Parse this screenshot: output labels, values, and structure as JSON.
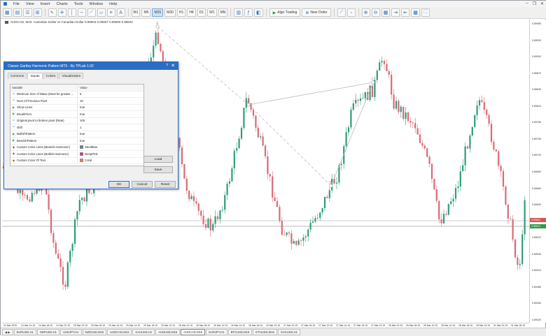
{
  "menu": {
    "items": [
      "File",
      "View",
      "Insert",
      "Charts",
      "Tools",
      "Window",
      "Help"
    ]
  },
  "toolbar": {
    "timeframes": [
      "M1",
      "M5",
      "M15",
      "M30",
      "H1",
      "H4",
      "D1",
      "W1",
      "MN"
    ],
    "active_timeframe": "M15",
    "algo_label": "Algo Trading",
    "new_order_label": "New Order"
  },
  "chart": {
    "info": "AUDCAD, M15: Australian Dollar vs Canadian Dollar 0.89603 0.89607 0.89590 0.89602",
    "pattern_points": [
      "X",
      "A",
      "B",
      "C"
    ],
    "price_labels": [
      "0.89960",
      "0.89930",
      "0.89900",
      "0.89870",
      "0.89840",
      "0.89810",
      "0.89780",
      "0.89750",
      "0.89720",
      "0.89690",
      "0.89660",
      "0.89630",
      "0.89600",
      "0.89570",
      "0.89540",
      "0.89510",
      "0.89480",
      "0.89450",
      "0.89420"
    ],
    "bid_label": "0.89602",
    "ask_label": "0.89612",
    "time_labels": [
      "24 Mar 2025",
      "24 Mar 14:15",
      "24 Mar 18:15",
      "24 Mar 22:15",
      "25 Mar 02:15",
      "25 Mar 06:15",
      "25 Mar 10:15",
      "25 Mar 14:15",
      "25 Mar 18:15",
      "25 Mar 22:15",
      "26 Mar 02:15",
      "26 Mar 06:15",
      "26 Mar 10:15",
      "26 Mar 14:15",
      "26 Mar 18:15",
      "26 Mar 22:15",
      "27 Mar 02:15",
      "27 Mar 06:15",
      "27 Mar 10:15",
      "27 Mar 14:15",
      "27 Mar 18:15",
      "27 Mar 22:15",
      "28 Mar 02:15",
      "28 Mar 06:15",
      "28 Mar 10:15",
      "28 Mar 14:15",
      "28 Mar 18:15",
      "28 Mar 22:15",
      "31 Mar 02:15",
      "31 Mar 06:15"
    ]
  },
  "symbol_tabs": [
    "EURUSD,H1",
    "GBPUSD,H1",
    "USDJPY,H1",
    "NZDUSD,M15",
    "USDCAD,M15",
    "XAUUSD,H1",
    "AUDUSD,M15",
    "AUDCAD,M15",
    "EURJPY,H1",
    "BTCUSD,M15",
    "ETHUSD,M15",
    "XAGUSD,H1"
  ],
  "active_symbol_tab": "AUDCAD,M15",
  "dialog": {
    "title": "Classic Gartley Harmonic Pattern MT5 - By TPLab 1.02",
    "tabs": [
      "Common",
      "Inputs",
      "Colors",
      "Visualization"
    ],
    "active_tab": "Inputs",
    "col_variable": "Variable",
    "col_value": "Value",
    "params": [
      {
        "name": "Minimum Size of Wave (Must be greater ...",
        "value": "5",
        "icon": "number-icon"
      },
      {
        "name": "Num Of Previous Pivot",
        "value": "10",
        "icon": "number-icon"
      },
      {
        "name": "Show Lines",
        "value": "true",
        "icon": "boolean-icon"
      },
      {
        "name": "BreakPivot",
        "value": "true",
        "icon": "boolean-icon"
      },
      {
        "name": "Original pivot to broken pivot (Rate)",
        "value": "100",
        "icon": "number-icon"
      },
      {
        "name": "shift",
        "value": "1",
        "icon": "number-icon"
      },
      {
        "name": "BullishPattern",
        "value": "true",
        "icon": "boolean-icon"
      },
      {
        "name": "BearishPattern",
        "value": "true",
        "icon": "boolean-icon"
      },
      {
        "name": "Custom Color Lines (Bearish Harmonic)",
        "value": "SteelBlue",
        "icon": "color-icon",
        "color": "#4682b4"
      },
      {
        "name": "Custom Color Lines (Bullish Harmonic)",
        "value": "DeepPink",
        "icon": "color-icon",
        "color": "#ff1493"
      },
      {
        "name": "Custom Color Of Text",
        "value": "Coral",
        "icon": "color-icon",
        "color": "#ff7f50"
      }
    ],
    "load_label": "Load",
    "save_label": "Save",
    "ok_label": "OK",
    "cancel_label": "Cancel",
    "reset_label": "Reset"
  },
  "colors": {
    "bull": "#2e9c7a",
    "bear": "#d96a76",
    "pattern_line": "#bbbbbb",
    "bid": "#d9534f",
    "ask": "#2e9b45",
    "dialog_accent": "#2b6cc4"
  }
}
